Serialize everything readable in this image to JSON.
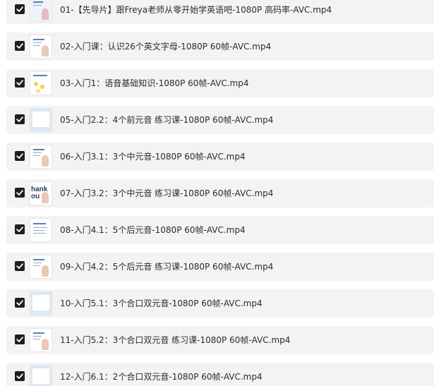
{
  "files": [
    {
      "name": "01-【先导片】跟Freya老师从零开始学英语吧-1080P 高码率-AVC.mp4",
      "checked": true,
      "thumb": "intro"
    },
    {
      "name": "02-入门课：认识26个英文字母-1080P 60帧-AVC.mp4",
      "checked": true,
      "thumb": "slide-figure"
    },
    {
      "name": "03-入门1：语音基础知识-1080P 60帧-AVC.mp4",
      "checked": true,
      "thumb": "dots"
    },
    {
      "name": "05-入门2.2：4个前元音 练习课-1080P 60帧-AVC.mp4",
      "checked": true,
      "thumb": "blue-frame"
    },
    {
      "name": "06-入门3.1：3个中元音-1080P 60帧-AVC.mp4",
      "checked": true,
      "thumb": "slide-figure"
    },
    {
      "name": "07-入门3.2：3个中元音 练习课-1080P 60帧-AVC.mp4",
      "checked": true,
      "thumb": "thank-you"
    },
    {
      "name": "08-入门4.1：5个后元音-1080P 60帧-AVC.mp4",
      "checked": true,
      "thumb": "slide-text"
    },
    {
      "name": "09-入门4.2：5个后元音 练习课-1080P 60帧-AVC.mp4",
      "checked": true,
      "thumb": "slide-figure"
    },
    {
      "name": "10-入门5.1：3个合口双元音-1080P 60帧-AVC.mp4",
      "checked": true,
      "thumb": "blue-frame"
    },
    {
      "name": "11-入门5.2：3个合口双元音 练习课-1080P 60帧-AVC.mp4",
      "checked": true,
      "thumb": "slide-figure"
    },
    {
      "name": "12-入门6.1：2个合口双元音-1080P 60帧-AVC.mp4",
      "checked": true,
      "thumb": "blue-frame"
    }
  ],
  "thumb_text": {
    "thank-you": "hank\nou"
  },
  "colors": {
    "row_background": "#f3f3f3",
    "checkbox": "#1f1f1f",
    "text": "#2b2b2b"
  },
  "icons": {
    "checkbox": "checkmark-icon"
  }
}
